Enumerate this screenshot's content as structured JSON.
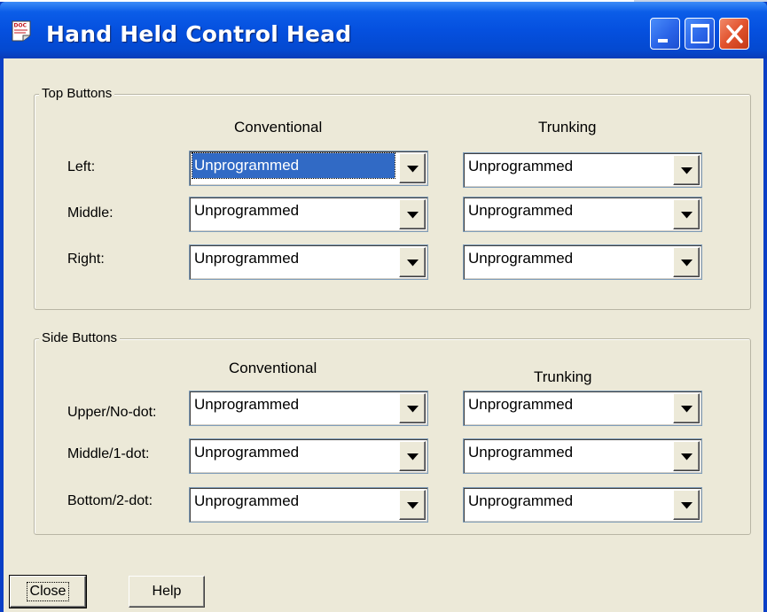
{
  "window": {
    "title": "Hand Held Control Head",
    "icon_label": "DOC"
  },
  "columns": {
    "conventional": "Conventional",
    "trunking": "Trunking"
  },
  "top_buttons": {
    "legend": "Top Buttons",
    "rows": [
      {
        "label": "Left:",
        "conventional": "Unprogrammed",
        "trunking": "Unprogrammed"
      },
      {
        "label": "Middle:",
        "conventional": "Unprogrammed",
        "trunking": "Unprogrammed"
      },
      {
        "label": "Right:",
        "conventional": "Unprogrammed",
        "trunking": "Unprogrammed"
      }
    ]
  },
  "side_buttons": {
    "legend": "Side Buttons",
    "rows": [
      {
        "label": "Upper/No-dot:",
        "conventional": "Unprogrammed",
        "trunking": "Unprogrammed"
      },
      {
        "label": "Middle/1-dot:",
        "conventional": "Unprogrammed",
        "trunking": "Unprogrammed"
      },
      {
        "label": "Bottom/2-dot:",
        "conventional": "Unprogrammed",
        "trunking": "Unprogrammed"
      }
    ]
  },
  "footer": {
    "close_label": "Close",
    "help_label": "Help"
  },
  "colors": {
    "titlebar": "#0550df",
    "dialog_bg": "#ece9d8",
    "selection": "#316ac5",
    "close_button": "#e2532e"
  },
  "icons": [
    "app-document-icon",
    "minimize-icon",
    "maximize-icon",
    "close-icon",
    "dropdown-arrow-icon"
  ]
}
